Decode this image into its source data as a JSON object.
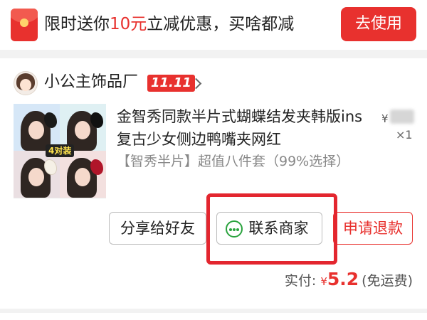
{
  "promo": {
    "text_before": "限时送你",
    "text_amount": "10元",
    "text_after": "立减优惠，买啥都减",
    "button": "去使用",
    "icon": "red-envelope-icon"
  },
  "shop": {
    "name": "小公主饰品厂",
    "badge": "11.11",
    "chevron": "›"
  },
  "product": {
    "title": "金智秀同款半片式蝴蝶结发夹韩版ins复古少女侧边鸭嘴夹网红",
    "price_symbol": "¥",
    "quantity": "×1",
    "sku": "【智秀半片】超值八件套（99%选择）",
    "thumb_tag": "4对装"
  },
  "actions": {
    "share": "分享给好友",
    "contact": "联系商家",
    "refund": "申请退款"
  },
  "total": {
    "label": "实付:",
    "currency": "¥",
    "amount": "5.2",
    "note": "(免运费)"
  },
  "colors": {
    "accent": "#e8312e",
    "chat": "#2aa33e"
  }
}
